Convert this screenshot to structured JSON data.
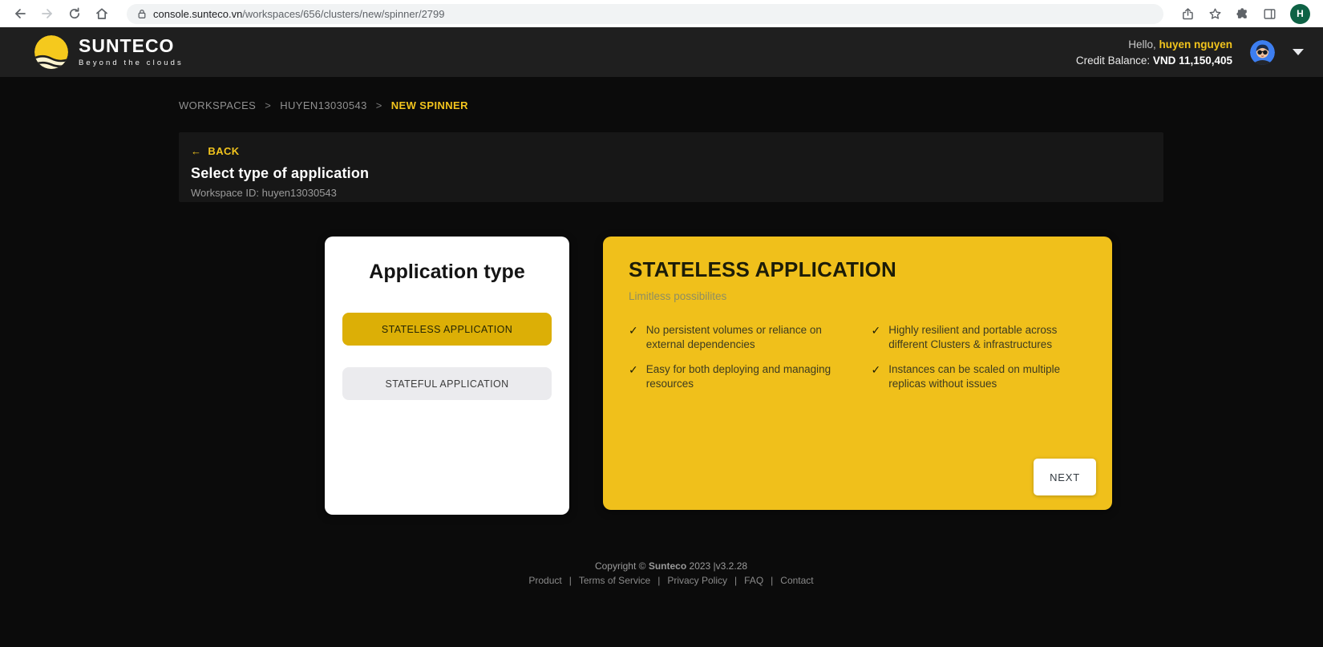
{
  "browser": {
    "url": {
      "host": "console.sunteco.vn",
      "path": "/workspaces/656/clusters/new/spinner/2799"
    },
    "profile_initial": "H"
  },
  "header": {
    "brand": {
      "name": "SUNTECO",
      "tagline": "Beyond the clouds"
    },
    "greeting": {
      "prefix": "Hello, ",
      "username": "huyen nguyen"
    },
    "credit": {
      "label": "Credit Balance: ",
      "value": "VND 11,150,405"
    }
  },
  "breadcrumb": {
    "separator": ">",
    "items": [
      {
        "label": "WORKSPACES"
      },
      {
        "label": "HUYEN13030543"
      },
      {
        "label": "NEW SPINNER"
      }
    ]
  },
  "page": {
    "back_label": "BACK",
    "title": "Select type of application",
    "workspace_id_label": "Workspace ID: huyen13030543"
  },
  "selector": {
    "title": "Application type",
    "options": [
      {
        "label": "STATELESS APPLICATION",
        "selected": true
      },
      {
        "label": "STATEFUL APPLICATION",
        "selected": false
      }
    ]
  },
  "detail": {
    "title": "STATELESS APPLICATION",
    "subtitle": "Limitless possibilites",
    "features": [
      "No persistent volumes or reliance on external dependencies",
      "Easy for both deploying and managing resources",
      "Highly resilient and portable across different Clusters & infrastructures",
      "Instances can be scaled on multiple replicas without issues"
    ],
    "next_label": "NEXT"
  },
  "footer": {
    "copyright_prefix": "Copyright ©",
    "brand": "Sunteco",
    "version": "2023 |v3.2.28",
    "separator": "|",
    "links": [
      "Product",
      "Terms of Service",
      "Privacy Policy",
      "FAQ",
      "Contact"
    ]
  },
  "icons": {
    "back_arrow": "←",
    "check": "✓"
  },
  "colors": {
    "accent_yellow": "#F2C41D",
    "card_yellow": "#F0C01B",
    "selected_option_yellow": "#DCAF06",
    "header_bg": "#1F1F1F",
    "page_bg": "#0B0B0B",
    "panel_bg": "#171717",
    "browser_profile_green": "#0E6245",
    "avatar_blue": "#3D7EF0"
  }
}
